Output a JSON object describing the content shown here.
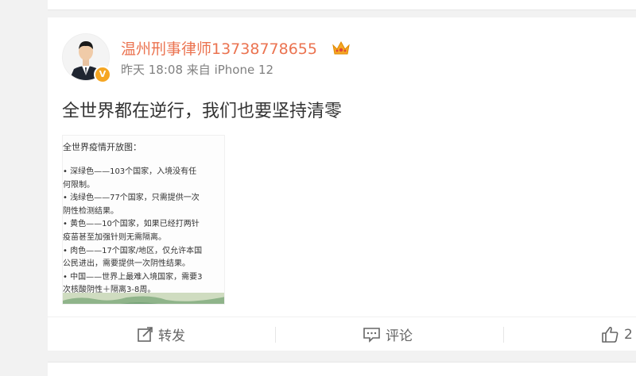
{
  "post": {
    "user_name": "温州刑事律师13738778655",
    "time": "昨天 18:08",
    "source_prefix": "来自",
    "source": "iPhone 12",
    "text": "全世界都在逆行，我们也要坚持清零",
    "image": {
      "title": "全世界疫情开放图：",
      "lines": [
        "• 深绿色——103个国家，入境没有任",
        "何限制。",
        "• 浅绿色——77个国家，只需提供一次",
        "阴性检测结果。",
        "• 黄色——10个国家，如果已经打两针",
        "疫苗甚至加强针则无需隔离。",
        "• 肉色——17个国家/地区，仅允许本国",
        "公民进出，需要提供一次阴性结果。",
        "• 中国——世界上最难入境国家，需要3",
        "次核酸阴性＋隔离3-8周。"
      ]
    }
  },
  "actions": {
    "forward_label": "转发",
    "comment_label": "评论",
    "like_count": "2"
  },
  "colors": {
    "username": "#eb7350",
    "meta": "#808080",
    "verify_badge": "#f5a623",
    "crown": "#f5a623"
  },
  "icons": {
    "forward": "share-icon",
    "comment": "comment-icon",
    "like": "thumbs-up-icon",
    "crown": "crown-icon",
    "verified": "verified-badge-icon"
  }
}
